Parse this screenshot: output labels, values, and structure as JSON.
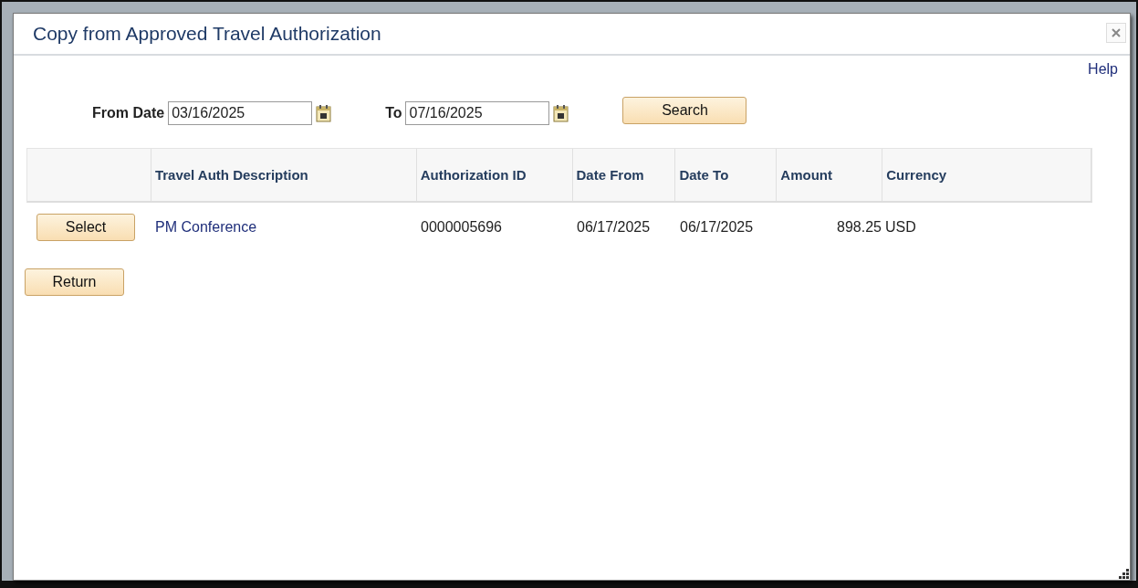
{
  "dialog": {
    "title": "Copy from Approved Travel Authorization",
    "help_link": "Help"
  },
  "filters": [
    {
      "label": "From Date",
      "value": "03/16/2025"
    },
    {
      "label": "To",
      "value": "07/16/2025"
    }
  ],
  "search_button": "Search",
  "table": {
    "columns": [
      "Travel Auth Description",
      "Authorization ID",
      "Date From",
      "Date To",
      "Amount",
      "Currency"
    ],
    "rows": [
      {
        "select_button": "Select",
        "description": "PM Conference",
        "authorization_id": "0000005696",
        "date_from": "06/17/2025",
        "date_to": "06/17/2025",
        "amount": "898.25",
        "currency": "USD"
      }
    ]
  },
  "return_button": "Return"
}
